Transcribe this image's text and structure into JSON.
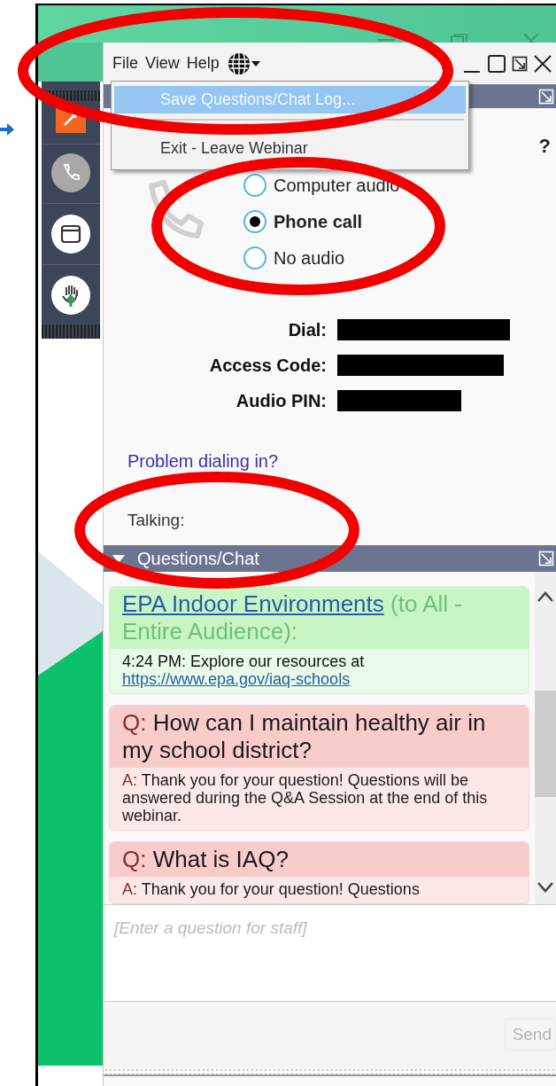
{
  "menu_bar": {
    "items": [
      "File",
      "View",
      "Help"
    ]
  },
  "dropdown_menu": {
    "items": [
      {
        "label": "Save Questions/Chat Log...",
        "selected": true
      },
      {
        "label": "Exit - Leave Webinar",
        "selected": false
      }
    ]
  },
  "audio": {
    "help": "?",
    "options": [
      {
        "label": "Computer audio",
        "selected": false
      },
      {
        "label": "Phone call",
        "selected": true
      },
      {
        "label": "No audio",
        "selected": false
      }
    ],
    "details": [
      {
        "label": "Dial:"
      },
      {
        "label": "Access Code:"
      },
      {
        "label": "Audio PIN:"
      }
    ],
    "problem_link": "Problem dialing in?",
    "talking": "Talking:"
  },
  "chat": {
    "title": "Questions/Chat",
    "messages": [
      {
        "kind": "broadcast",
        "sender": "EPA Indoor Environments",
        "audience": "(to All - Entire Audience):",
        "time": "4:24 PM:",
        "text": "Explore our resources at",
        "link": "https://www.epa.gov/iaq-schools"
      },
      {
        "kind": "question",
        "prefix": "Q:",
        "question": "How can I maintain healthy air in my school district?",
        "answer_prefix": "A:",
        "answer": "Thank you for your question! Questions will be answered during the Q&A Session at the end of this webinar."
      },
      {
        "kind": "question",
        "prefix": "Q:",
        "question": "What is IAQ?",
        "answer_prefix": "A:",
        "answer": "Thank you for your question! Questions"
      }
    ],
    "input": {
      "placeholder": "[Enter a question for staff]"
    },
    "send": "Send"
  }
}
